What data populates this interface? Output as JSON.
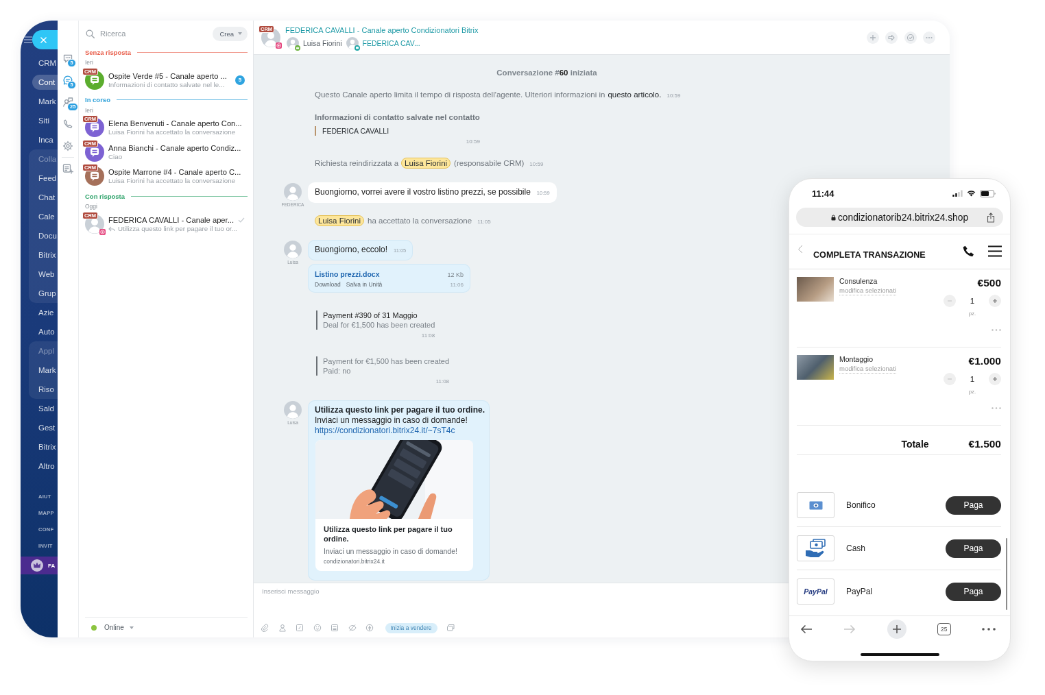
{
  "app_nav": {
    "items": [
      {
        "kind": "link",
        "label": "CRM",
        "selected": false
      },
      {
        "kind": "link",
        "label": "Cont",
        "selected": true
      },
      {
        "kind": "link",
        "label": "Mark",
        "selected": false
      },
      {
        "kind": "link",
        "label": "Siti",
        "selected": false
      },
      {
        "kind": "link",
        "label": "Inca",
        "selected": false
      },
      {
        "kind": "group",
        "label": "Colla",
        "selected": false,
        "children": [
          {
            "kind": "link",
            "label": "Feed",
            "selected": false
          },
          {
            "kind": "link",
            "label": "Chat",
            "selected": false
          },
          {
            "kind": "link",
            "label": "Cale",
            "selected": false
          },
          {
            "kind": "link",
            "label": "Docu",
            "selected": false
          },
          {
            "kind": "link",
            "label": "Bitrix",
            "selected": false
          },
          {
            "kind": "link",
            "label": "Web",
            "selected": false
          },
          {
            "kind": "link",
            "label": "Grup",
            "selected": false
          }
        ]
      },
      {
        "kind": "link",
        "label": "Azie",
        "selected": false
      },
      {
        "kind": "link",
        "label": "Auto",
        "selected": false
      },
      {
        "kind": "group",
        "label": "Appl",
        "selected": false,
        "children": [
          {
            "kind": "link",
            "label": "Mark",
            "selected": false
          },
          {
            "kind": "link",
            "label": "Riso",
            "selected": false
          }
        ]
      },
      {
        "kind": "link",
        "label": "Sald",
        "selected": false
      },
      {
        "kind": "link",
        "label": "Gest",
        "selected": false
      },
      {
        "kind": "link",
        "label": "Bitrix",
        "selected": false
      },
      {
        "kind": "link",
        "label": "Altro",
        "selected": false
      }
    ],
    "footer_links": [
      "AIUT",
      "MAPP",
      "CONF",
      "INVIT"
    ],
    "promo": {
      "label": "FA"
    }
  },
  "tool_rail": {
    "items": [
      {
        "kind": "chats",
        "badge": "5",
        "selected": false
      },
      {
        "kind": "channels",
        "badge": "5",
        "selected": true
      },
      {
        "kind": "recent",
        "badge": "25",
        "selected": false
      },
      {
        "kind": "calls",
        "selected": false
      },
      {
        "kind": "settings",
        "selected": false
      },
      {
        "kind": "notes",
        "selected": false
      }
    ]
  },
  "chat_list": {
    "search": {
      "placeholder": "Ricerca"
    },
    "create_button": "Crea",
    "sections": [
      {
        "title": "Senza risposta",
        "color": "#e9604d",
        "date": "Ieri",
        "chats": [
          {
            "kind": "icon",
            "color": "#5bad2e",
            "badge": "CRM",
            "title": "Ospite Verde #5 - Canale aperto ...",
            "preview": "Informazioni di contatto salvate nel le...",
            "unread": "5",
            "outgoing": false,
            "delivered": false,
            "selected": false
          }
        ]
      },
      {
        "title": "In corso",
        "color": "#2a9fd8",
        "date": "Ieri",
        "chats": [
          {
            "kind": "icon",
            "color": "#7d62d3",
            "badge": "CRM",
            "title": "Elena Benvenuti - Canale aperto Con...",
            "preview": "Luisa Fiorini ha accettato la conversazione",
            "outgoing": false,
            "delivered": false,
            "selected": false
          },
          {
            "kind": "icon",
            "color": "#7d62d3",
            "badge": "CRM",
            "title": "Anna Bianchi - Canale aperto Condiz...",
            "preview": "Ciao",
            "outgoing": false,
            "delivered": false,
            "selected": false
          },
          {
            "kind": "icon",
            "color": "#a5705a",
            "badge": "CRM",
            "title": "Ospite Marrone #4 - Canale aperto C...",
            "preview": "Luisa Fiorini ha accettato la conversazione",
            "outgoing": false,
            "delivered": false,
            "selected": false
          }
        ]
      },
      {
        "title": "Con risposta",
        "color": "#2fa36b",
        "date": "Oggi",
        "chats": [
          {
            "kind": "photo",
            "badge": "CRM",
            "title": "FEDERICA CAVALLI - Canale aper...",
            "preview": "Utilizza questo link per pagare il tuo or...",
            "outgoing": true,
            "delivered": true,
            "selected": false
          }
        ]
      }
    ],
    "status": {
      "label": "Online",
      "color": "#8cc43f"
    }
  },
  "conversation": {
    "header": {
      "badge": "CRM",
      "title": "FEDERICA CAVALLI - Canale aperto Condizionatori Bitrix",
      "participants": [
        {
          "kind": "operator",
          "name": "Luisa Fiorini"
        },
        {
          "kind": "client",
          "name": "FEDERICA CAV..."
        }
      ]
    },
    "messages": [
      {
        "kind": "header",
        "text": "Conversazione #**60** iniziata"
      },
      {
        "kind": "notice",
        "text": "Questo Canale aperto limita il tempo di risposta dell'agente. Ulteriori informazioni in",
        "link": "questo articolo.",
        "time": "10:59"
      },
      {
        "kind": "contact",
        "title": "Informazioni di contatto salvate nel contatto",
        "quote": "FEDERICA CAVALLI",
        "time": "10:59"
      },
      {
        "kind": "mention",
        "before": "Richiesta reindirizzata a",
        "mention": "Luisa Fiorini",
        "after": "(responsabile CRM)",
        "time": "10:59"
      },
      {
        "kind": "incoming",
        "author": "FEDERICA",
        "text": "Buongiorno, vorrei avere il vostro listino prezzi, se possibile",
        "time": "10:59"
      },
      {
        "kind": "mention",
        "mention": "Luisa Fiorini",
        "after": "ha accettato la conversazione",
        "time": "11:05"
      },
      {
        "kind": "outgoing",
        "author": "Luisa",
        "text": "Buongiorno, eccolo!",
        "time": "11:05",
        "file": {
          "name": "Listino prezzi.docx",
          "size": "12 Kb",
          "actions": [
            "Download",
            "Salva in Unità"
          ],
          "time": "11:06"
        }
      },
      {
        "kind": "payment",
        "title": "Payment #390 of 31 Maggio",
        "lines": [
          "Deal for €1,500 has been created"
        ],
        "time": "11:08"
      },
      {
        "kind": "payment",
        "lines": [
          "Payment for €1,500 has been created",
          "Paid: no"
        ],
        "time": "11:08"
      },
      {
        "kind": "outgoing",
        "author": "Luisa",
        "title": "Utilizza questo link per pagare il tuo ordine.",
        "text": "Inviaci un messaggio in caso di domande!",
        "url": "https://condizionatori.bitrix24.it/~7sT4c",
        "preview": {
          "title": "Utilizza questo link per pagare il tuo ordine.",
          "description": "Inviaci un messaggio in caso di domande!",
          "domain": "condizionatori.bitrix24.it"
        }
      }
    ],
    "composer": {
      "placeholder": "Inserisci messaggio",
      "sell_button": "Inizia a vendere"
    }
  },
  "phone": {
    "time": "11:44",
    "url": "condizionatorib24.bitrix24.shop",
    "title": "COMPLETA TRANSAZIONE",
    "products": [
      {
        "name": "Consulenza",
        "edit_link": "modifica selezionati",
        "price": "€500",
        "quantity": "1",
        "unit": "pz."
      },
      {
        "name": "Montaggio",
        "edit_link": "modifica selezionati",
        "price": "€1.000",
        "quantity": "1",
        "unit": "pz."
      }
    ],
    "total": {
      "label": "Totale",
      "value": "€1.500"
    },
    "payment_methods": [
      {
        "kind": "bank",
        "name": "Bonifico",
        "button": "Paga"
      },
      {
        "kind": "cash",
        "name": "Cash",
        "button": "Paga"
      },
      {
        "kind": "paypal",
        "name": "PayPal",
        "logo_text": "PayPal",
        "button": "Paga"
      }
    ],
    "browser_bar": {
      "back_disabled": false,
      "forward_disabled": true,
      "tabs_count": "25"
    }
  }
}
